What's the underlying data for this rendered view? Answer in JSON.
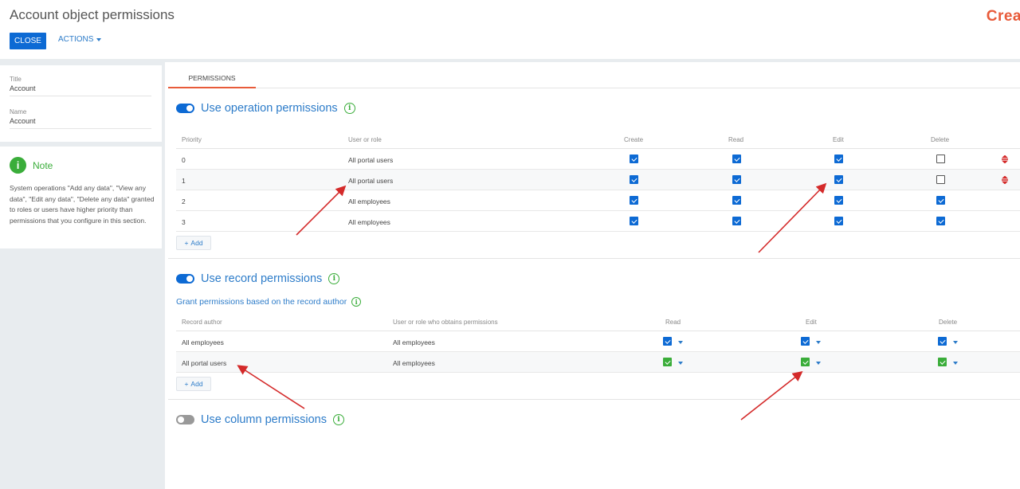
{
  "header": {
    "title": "Account object permissions",
    "brand": "Crea",
    "close_label": "CLOSE",
    "actions_label": "ACTIONS"
  },
  "left": {
    "fields": [
      {
        "label": "Title",
        "value": "Account"
      },
      {
        "label": "Name",
        "value": "Account"
      }
    ],
    "note": {
      "title": "Note",
      "text": "System operations \"Add any data\", \"View any data\", \"Edit any data\", \"Delete any data\" granted to roles or users have higher priority than permissions that you configure in this section."
    }
  },
  "tabs": [
    {
      "label": "PERMISSIONS"
    }
  ],
  "operation": {
    "title": "Use operation permissions",
    "enabled": true,
    "columns": [
      "Priority",
      "User or role",
      "Create",
      "Read",
      "Edit",
      "Delete"
    ],
    "rows": [
      {
        "priority": "0",
        "user": "All portal users",
        "create": true,
        "read": true,
        "edit": true,
        "delete": false
      },
      {
        "priority": "1",
        "user": "All portal users",
        "create": true,
        "read": true,
        "edit": true,
        "delete": false
      },
      {
        "priority": "2",
        "user": "All employees",
        "create": true,
        "read": true,
        "edit": true,
        "delete": true
      },
      {
        "priority": "3",
        "user": "All employees",
        "create": true,
        "read": true,
        "edit": true,
        "delete": true
      }
    ],
    "add_label": "Add"
  },
  "record": {
    "title": "Use record permissions",
    "enabled": true,
    "subtitle": "Grant permissions based on the record author",
    "columns": [
      "Record author",
      "User or role who obtains permissions",
      "Read",
      "Edit",
      "Delete"
    ],
    "rows": [
      {
        "author": "All employees",
        "user": "All employees",
        "level": "blue"
      },
      {
        "author": "All portal users",
        "user": "All employees",
        "level": "green"
      }
    ],
    "add_label": "Add"
  },
  "column": {
    "title": "Use column permissions",
    "enabled": false
  },
  "colors": {
    "accent": "#0d6ad4",
    "link": "#2d7cc9",
    "green": "#3aad3a",
    "brand": "#e85b3a",
    "arrow": "#d42a2a"
  }
}
